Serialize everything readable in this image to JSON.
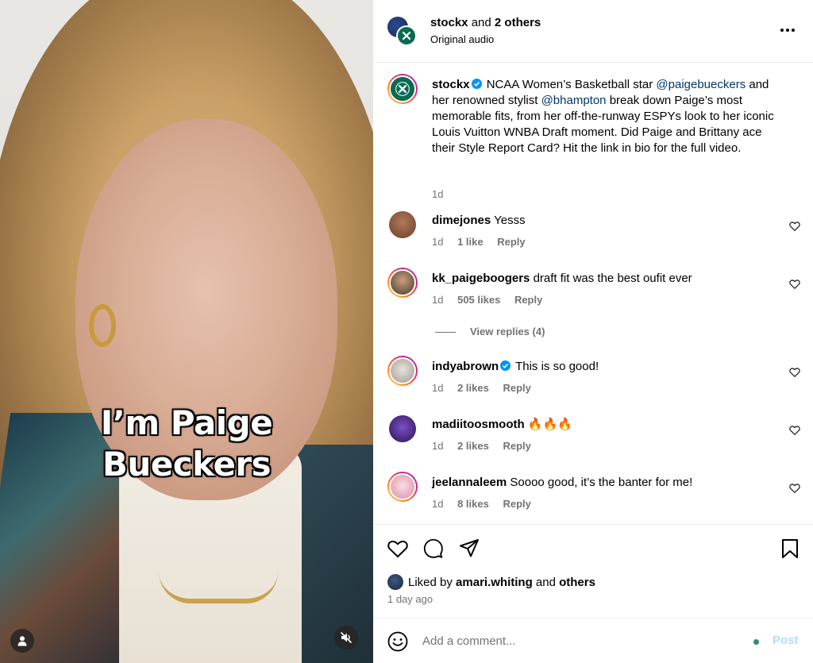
{
  "video": {
    "caption_line1": "I’m Paige",
    "caption_line2": "Bueckers",
    "user_icon": "person-icon",
    "mute_icon": "speaker-muted-icon"
  },
  "header": {
    "user": "stockx",
    "and_text": "and",
    "others": "2 others",
    "audio": "Original audio",
    "more_icon": "more-horizontal-icon"
  },
  "caption": {
    "user": "stockx",
    "text_1": " NCAA Women’s Basketball star ",
    "mention_1": "@paigebueckers",
    "text_2": " and her renowned stylist ",
    "mention_2": "@bhampton",
    "text_3": " break down Paige’s most memorable fits, from her off-the-runway ESPYs look to her iconic Louis Vuitton WNBA Draft moment. Did Paige and Brittany ace their Style Report Card? Hit the link in bio for the full video.",
    "time": "1d"
  },
  "comments": [
    {
      "user": "dimejones",
      "text": "Yesss",
      "time": "1d",
      "likes": "1 like",
      "reply": "Reply",
      "verified": false
    },
    {
      "user": "kk_paigeboogers",
      "text": "draft fit was the best oufit ever",
      "time": "1d",
      "likes": "505 likes",
      "reply": "Reply",
      "verified": false
    },
    {
      "user": "indyabrown",
      "text": "This is so good!",
      "time": "1d",
      "likes": "2 likes",
      "reply": "Reply",
      "verified": true
    },
    {
      "user": "madiitoosmooth",
      "text": "🔥🔥🔥",
      "time": "1d",
      "likes": "2 likes",
      "reply": "Reply",
      "verified": false
    },
    {
      "user": "jeelannaleem",
      "text": "Soooo good, it’s the banter for me!",
      "time": "1d",
      "likes": "8 likes",
      "reply": "Reply",
      "verified": false
    }
  ],
  "view_replies": "View replies (4)",
  "actions": {
    "liked_prefix": "Liked by",
    "liked_user": "amari.whiting",
    "liked_and": "and",
    "liked_others": "others",
    "time_ago": "1 day ago"
  },
  "comment_box": {
    "placeholder": "Add a comment...",
    "post_label": "Post"
  },
  "colors": {
    "mention": "#00376b",
    "meta_gray": "#737373",
    "post_disabled": "#b3dbff",
    "verified_blue": "#0095f6"
  }
}
